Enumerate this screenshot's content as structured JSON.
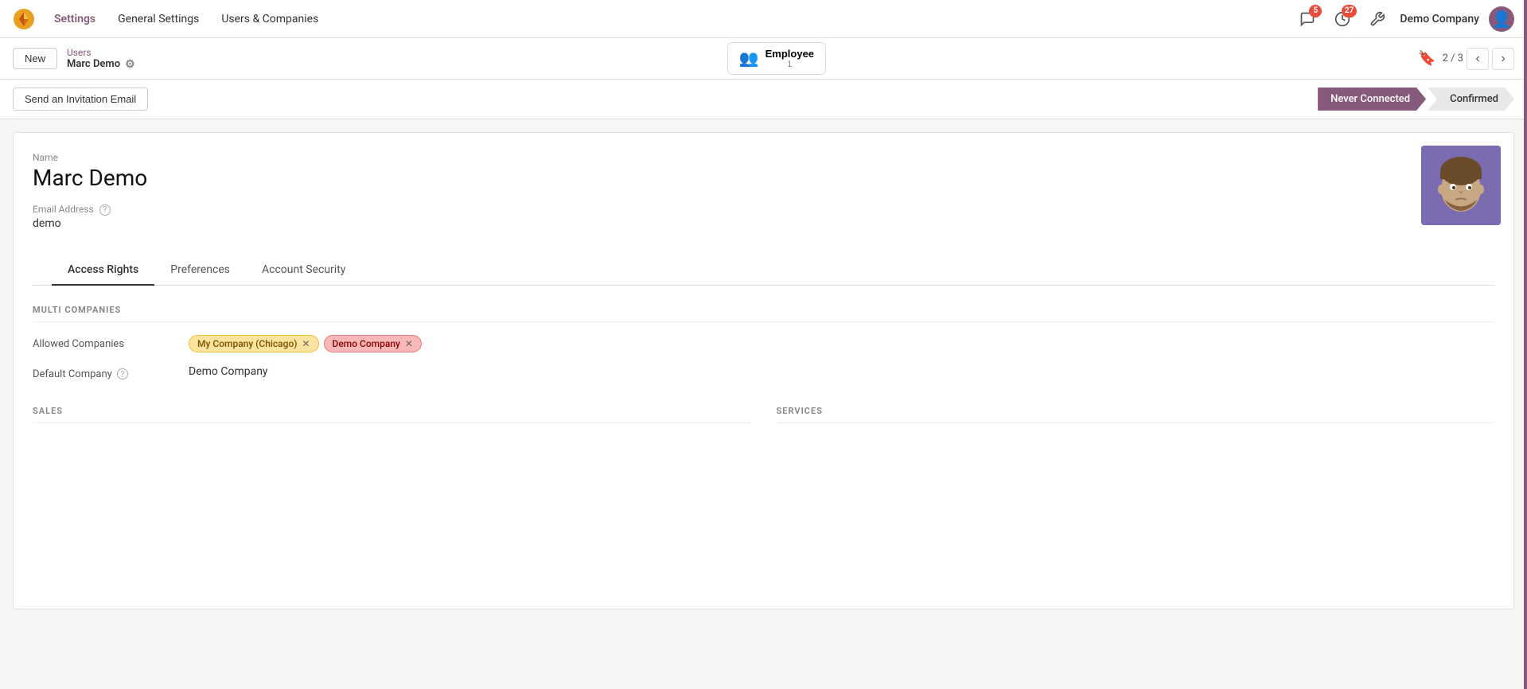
{
  "app": {
    "logo_text": "🔶",
    "nav_items": [
      {
        "id": "settings",
        "label": "Settings",
        "active": true
      },
      {
        "id": "general",
        "label": "General Settings",
        "active": false
      },
      {
        "id": "users_companies",
        "label": "Users & Companies",
        "active": false
      }
    ]
  },
  "topnav_right": {
    "chat_badge": "5",
    "clock_badge": "27",
    "company_name": "Demo Company"
  },
  "actionbar": {
    "new_label": "New",
    "breadcrumb_parent": "Users",
    "breadcrumb_current": "Marc Demo",
    "employee_button_label": "Employee",
    "employee_count": "1",
    "pager_current": "2",
    "pager_total": "3"
  },
  "statusbar": {
    "invite_button_label": "Send an Invitation Email",
    "steps": [
      {
        "id": "never_connected",
        "label": "Never Connected",
        "active": true
      },
      {
        "id": "confirmed",
        "label": "Confirmed",
        "active": false
      }
    ]
  },
  "user": {
    "name_label": "Name",
    "name_value": "Marc Demo",
    "email_label": "Email Address",
    "email_value": "demo"
  },
  "tabs": [
    {
      "id": "access_rights",
      "label": "Access Rights",
      "active": true
    },
    {
      "id": "preferences",
      "label": "Preferences",
      "active": false
    },
    {
      "id": "account_security",
      "label": "Account Security",
      "active": false
    }
  ],
  "access_rights": {
    "multi_companies_title": "MULTI COMPANIES",
    "allowed_companies_label": "Allowed Companies",
    "allowed_companies": [
      {
        "id": "chicago",
        "name": "My Company (Chicago)",
        "style": "yellow"
      },
      {
        "id": "demo",
        "name": "Demo Company",
        "style": "red"
      }
    ],
    "default_company_label": "Default Company",
    "default_company_value": "Demo Company",
    "sales_title": "SALES",
    "services_title": "SERVICES"
  }
}
